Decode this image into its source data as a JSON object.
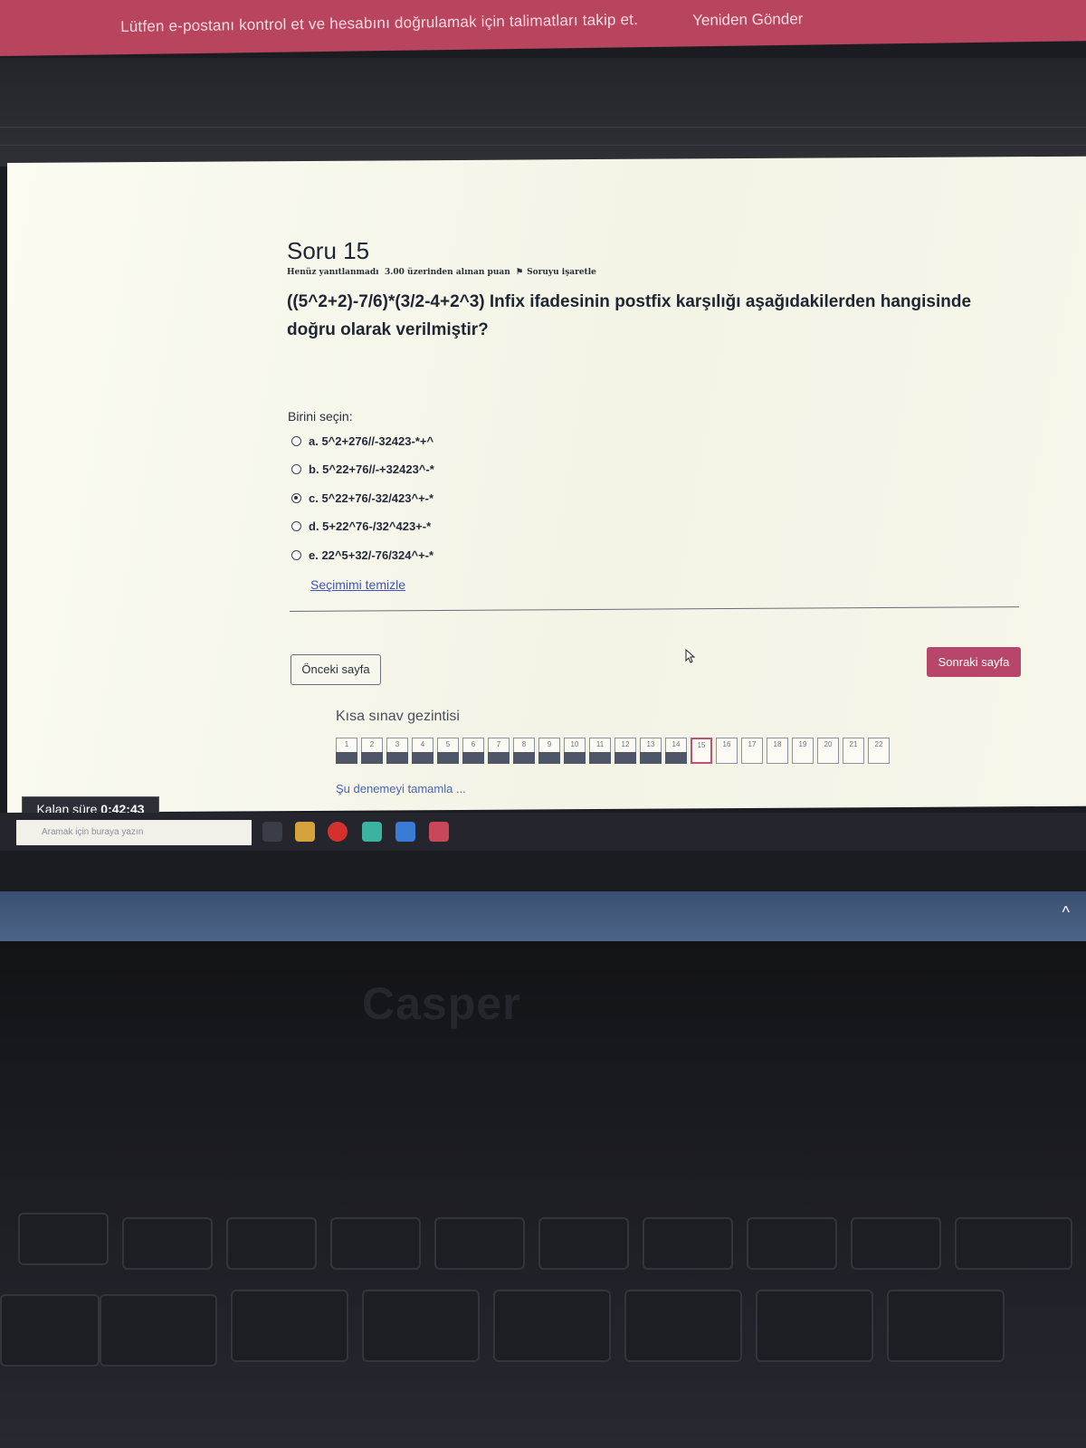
{
  "banner": {
    "text": "Lütfen e-postanı kontrol et ve hesabını doğrulamak için talimatları takip et.",
    "link": "Yeniden Gönder"
  },
  "question": {
    "title": "Soru 15",
    "status": "Henüz yanıtlanmadı",
    "points": "3.00 üzerinden alınan puan",
    "flag": "Soruyu işaretle",
    "text": "((5^2+2)-7/6)*(3/2-4+2^3) Infix ifadesinin postfix karşılığı aşağıdakilerden hangisinde doğru olarak verilmiştir?",
    "choose_label": "Birini seçin:",
    "options": [
      {
        "label": "a. 5^2+276//-32423-*+^",
        "checked": false
      },
      {
        "label": "b. 5^22+76//-+32423^-*",
        "checked": false
      },
      {
        "label": "c. 5^22+76/-32/423^+-*",
        "checked": true
      },
      {
        "label": "d. 5+22^76-/32^423+-*",
        "checked": false
      },
      {
        "label": "e. 22^5+32/-76/324^+-*",
        "checked": false
      }
    ],
    "clear_label": "Seçimimi temizle"
  },
  "navigation": {
    "prev_label": "Önceki sayfa",
    "next_label": "Sonraki sayfa",
    "quiz_nav_title": "Kısa sınav gezintisi",
    "pages": [
      "1",
      "2",
      "3",
      "4",
      "5",
      "6",
      "7",
      "8",
      "9",
      "10",
      "11",
      "12",
      "13",
      "14",
      "15",
      "16",
      "17",
      "18",
      "19",
      "20",
      "21",
      "22"
    ],
    "answered_count": 14,
    "current": "15",
    "finish_label": "Şu denemeyi tamamla ..."
  },
  "timer": {
    "label": "Kalan süre",
    "value": "0:42:43"
  },
  "taskbar": {
    "search_placeholder": "Aramak için buraya yazın"
  },
  "laptop": {
    "brand": "Casper"
  },
  "colors": {
    "accent": "#b8456a",
    "banner": "#b8445e",
    "link": "#3f57b8"
  }
}
